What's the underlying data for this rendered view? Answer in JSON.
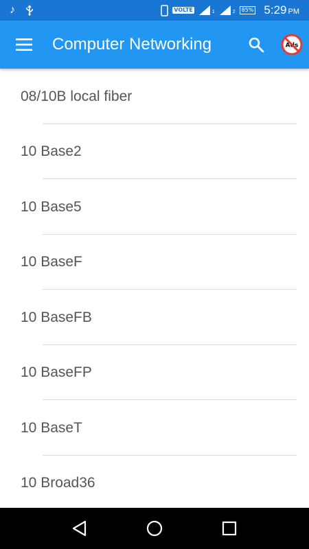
{
  "status_bar": {
    "volte": "VOLTE",
    "sim_label": "1",
    "sim2_label": "2",
    "battery": "85%",
    "time": "5:29",
    "time_suffix": "PM",
    "icons": [
      "music-note-icon",
      "usb-icon",
      "phone-icon",
      "signal-icon",
      "signal-icon",
      "battery-icon"
    ]
  },
  "app_bar": {
    "title": "Computer Networking",
    "ads_badge": "Ads",
    "icons": [
      "hamburger-menu-icon",
      "search-icon",
      "no-ads-icon"
    ],
    "color": "#2196f3",
    "status_color": "#1976d2"
  },
  "list": {
    "items": [
      {
        "label": "08/10B local fiber"
      },
      {
        "label": "10 Base2"
      },
      {
        "label": "10 Base5"
      },
      {
        "label": "10 BaseF"
      },
      {
        "label": "10 BaseFB"
      },
      {
        "label": "10 BaseFP"
      },
      {
        "label": "10 BaseT"
      },
      {
        "label": "10 Broad36"
      }
    ]
  },
  "nav_bar": {
    "icons": [
      "back-icon",
      "home-icon",
      "recents-icon"
    ]
  }
}
